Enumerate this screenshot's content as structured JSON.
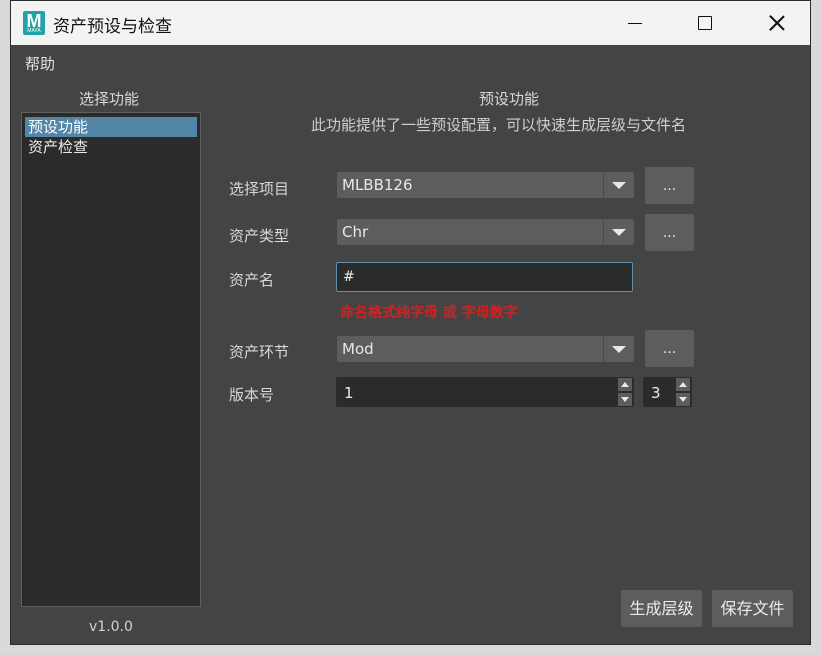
{
  "window": {
    "title": "资产预设与检查",
    "icon_letter": "M",
    "icon_sub": "MAYA"
  },
  "menu": {
    "help": "帮助"
  },
  "left_panel": {
    "title": "选择功能",
    "items": [
      {
        "label": "预设功能",
        "selected": true
      },
      {
        "label": "资产检查",
        "selected": false
      }
    ],
    "version": "v1.0.0"
  },
  "main": {
    "title": "预设功能",
    "description": "此功能提供了一些预设配置，可以快速生成层级与文件名",
    "project": {
      "label": "选择项目",
      "value": "MLBB126",
      "browse": "..."
    },
    "asset_type": {
      "label": "资产类型",
      "value": "Chr",
      "browse": "..."
    },
    "asset_name": {
      "label": "资产名",
      "value": "#"
    },
    "warning": "命名格式纯字母 或 字母数字",
    "asset_stage": {
      "label": "资产环节",
      "value": "Mod",
      "browse": "..."
    },
    "version": {
      "label": "版本号",
      "major": "1",
      "minor": "3"
    },
    "generate_button": "生成层级",
    "save_button": "保存文件"
  },
  "colors": {
    "background": "#444444",
    "selection": "#5285a6",
    "warning": "#d42020",
    "focus_border": "#5d8fb0"
  }
}
